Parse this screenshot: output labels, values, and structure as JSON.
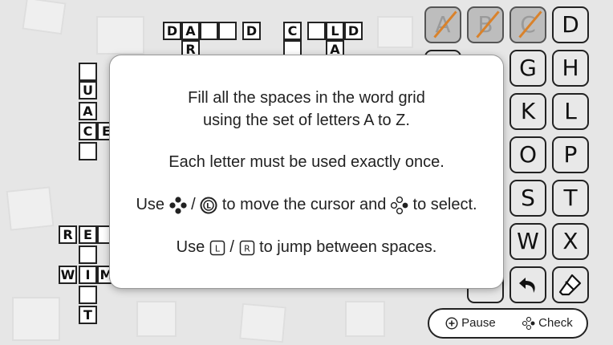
{
  "crossword": {
    "row1_left": [
      "D",
      "A",
      "",
      "",
      "D"
    ],
    "row1_right": [
      "C",
      "",
      "L",
      "D"
    ],
    "row2_left": [
      "R"
    ],
    "row2_right": [
      "",
      "A"
    ],
    "col_left": [
      "",
      "U",
      "A",
      "C",
      ""
    ],
    "col_left_extra": "E",
    "row_re": [
      "R",
      "E"
    ],
    "row_wi": [
      "W",
      "I",
      "M"
    ],
    "bottom": [
      "",
      "T"
    ]
  },
  "keyboard": {
    "keys": [
      {
        "letter": "A",
        "used": true
      },
      {
        "letter": "B",
        "used": true
      },
      {
        "letter": "C",
        "used": true
      },
      {
        "letter": "D",
        "used": false
      },
      {
        "letter": "G",
        "used": false
      },
      {
        "letter": "H",
        "used": false
      },
      {
        "letter": "K",
        "used": false
      },
      {
        "letter": "L",
        "used": false
      },
      {
        "letter": "O",
        "used": false
      },
      {
        "letter": "P",
        "used": false
      },
      {
        "letter": "S",
        "used": false
      },
      {
        "letter": "T",
        "used": false
      },
      {
        "letter": "W",
        "used": false
      },
      {
        "letter": "X",
        "used": false
      }
    ],
    "icons": [
      "undo-arrow-icon",
      "eraser-icon"
    ]
  },
  "dialog": {
    "line1": "Fill all the spaces in the word grid",
    "line2": "using the set of letters A to Z.",
    "line3": "Each letter must be used exactly once.",
    "line4_a": "Use",
    "line4_b": "/",
    "line4_c": "to move the cursor and",
    "line4_d": "to select.",
    "line5_a": "Use",
    "line5_b": "/",
    "line5_c": "to jump between spaces.",
    "button_l": "L",
    "button_r": "R",
    "stick_l": "L"
  },
  "footer": {
    "pause_label": "Pause",
    "check_label": "Check"
  },
  "colors": {
    "strike": "#d9822b",
    "ink": "#222222"
  }
}
